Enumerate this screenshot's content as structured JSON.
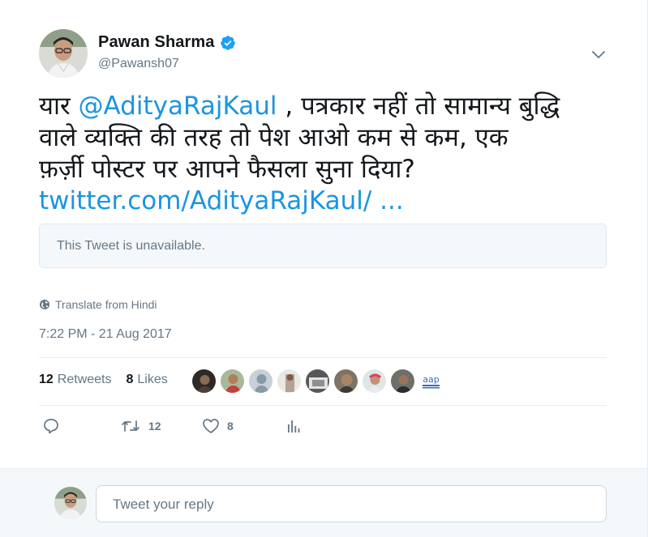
{
  "author": {
    "name": "Pawan Sharma",
    "handle": "@Pawansh07"
  },
  "tweet": {
    "lines": [
      {
        "pre": "यार ",
        "mention": "@AdityaRajKaul",
        "post": " , पत्रकार नहीं तो सामान्य बुद्धि"
      },
      {
        "text": "वाले व्यक्ति की तरह तो पेश आओ कम से कम, एक"
      },
      {
        "text": "फ़र्ज़ी पोस्टर पर आपने फैसला सुना दिया?"
      }
    ],
    "link": "twitter.com/AdityaRajKaul/ ...",
    "quoted_text": "This Tweet is unavailable.",
    "translate_label": "Translate from Hindi",
    "timestamp": "7:22 PM - 21 Aug 2017"
  },
  "stats": {
    "retweets_count": "12",
    "retweets_label": "Retweets",
    "likes_count": "8",
    "likes_label": "Likes"
  },
  "actions": {
    "retweet_count": "12",
    "like_count": "8"
  },
  "reply": {
    "placeholder": "Tweet your reply"
  },
  "colors": {
    "link": "#1b95e0",
    "muted": "#657786",
    "verified": "#1da1f2"
  },
  "icons": [
    "verified-badge-icon",
    "chevron-down-icon",
    "globe-icon",
    "reply-icon",
    "retweet-icon",
    "heart-icon",
    "analytics-icon"
  ]
}
